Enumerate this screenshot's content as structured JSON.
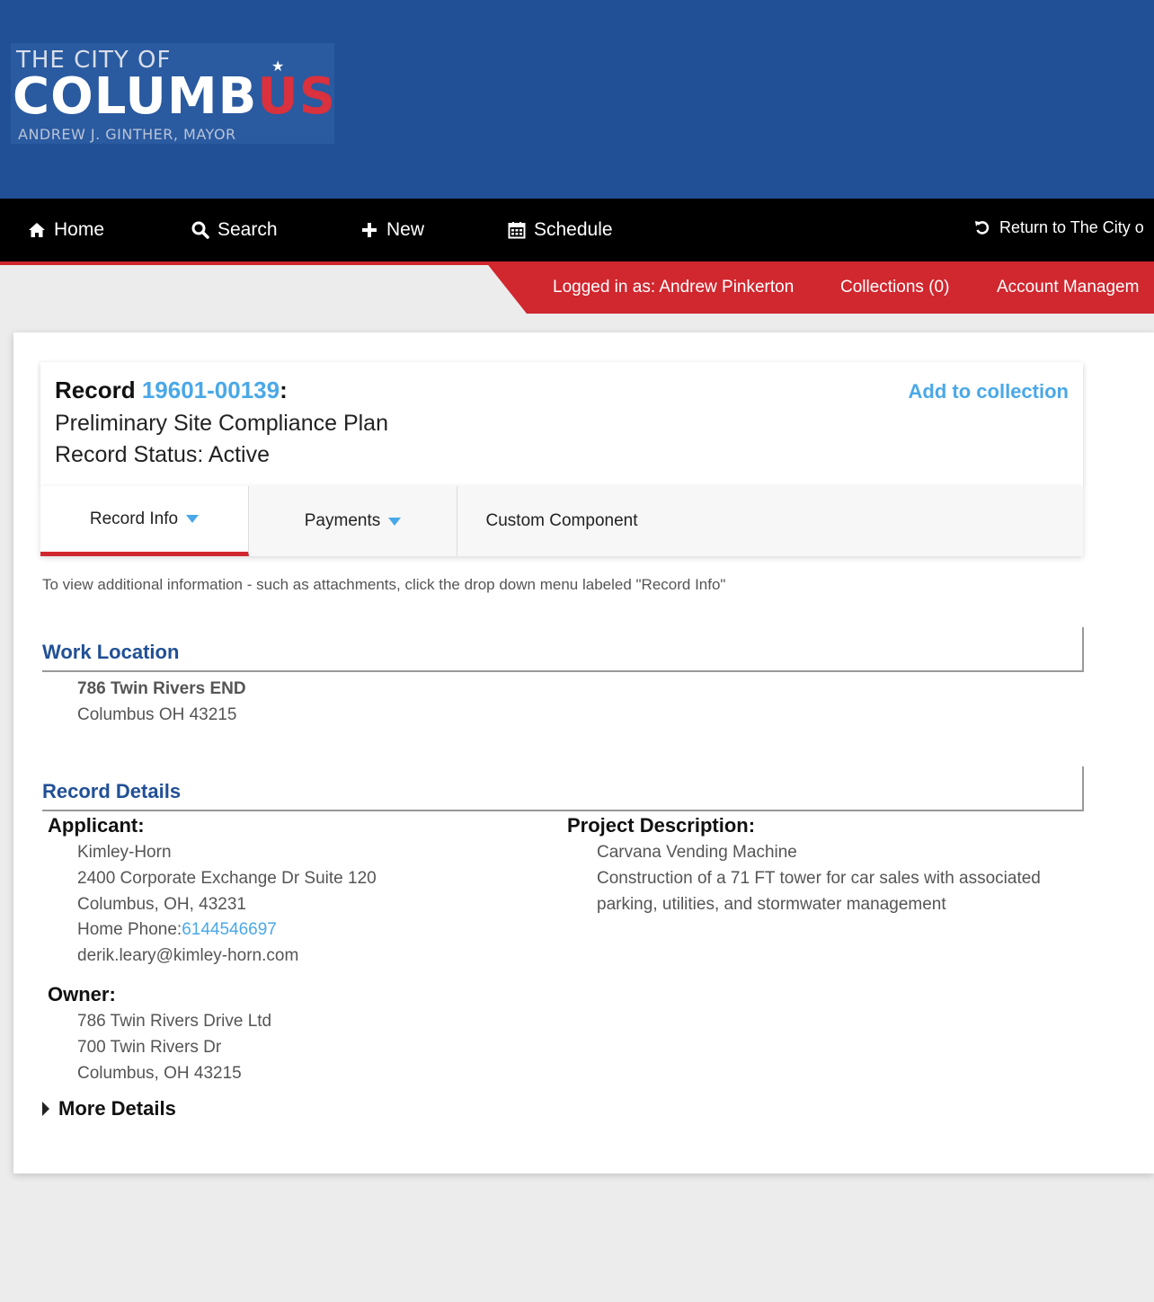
{
  "logo": {
    "line1": "THE CITY OF",
    "line2_main": "COLUMB",
    "line2_accent": "US",
    "line3": "ANDREW J. GINTHER, MAYOR"
  },
  "nav": {
    "home": "Home",
    "search": "Search",
    "new": "New",
    "schedule": "Schedule",
    "return": "Return to The City o"
  },
  "user_bar": {
    "logged_in": "Logged in as: Andrew Pinkerton",
    "collections": "Collections (0)",
    "account": "Account Managem"
  },
  "record": {
    "label": "Record",
    "number": "19601-00139",
    "colon": ":",
    "type": "Preliminary Site Compliance Plan",
    "status": "Record Status: Active",
    "add_to_collection": "Add to collection"
  },
  "tabs": {
    "record_info": "Record Info",
    "payments": "Payments",
    "custom": "Custom Component"
  },
  "hint": "To view additional information - such as attachments, click the drop down menu labeled \"Record Info\"",
  "work_location": {
    "title": "Work Location",
    "line1": "786 Twin Rivers END",
    "line2": "Columbus OH 43215"
  },
  "record_details": {
    "title": "Record Details",
    "applicant_label": "Applicant:",
    "applicant_name": "Kimley-Horn",
    "applicant_addr1": "2400 Corporate Exchange Dr Suite 120",
    "applicant_addr2": "Columbus, OH, 43231",
    "phone_label": "Home Phone:",
    "phone": "6144546697",
    "email": "derik.leary@kimley-horn.com",
    "owner_label": "Owner:",
    "owner_name": "786 Twin Rivers Drive Ltd",
    "owner_addr1": "700 Twin Rivers Dr",
    "owner_addr2": "Columbus, OH 43215",
    "project_label": "Project Description:",
    "project_name": "Carvana Vending Machine",
    "project_desc1": "Construction of a 71 FT tower for car sales with associated",
    "project_desc2": "parking, utilities, and stormwater management",
    "more_details": "More Details"
  },
  "colors": {
    "header_blue": "#215096",
    "accent_red": "#d1272f",
    "link_blue": "#4aa8e8"
  },
  "icons": [
    "home-icon",
    "search-icon",
    "plus-icon",
    "calendar-icon",
    "undo-icon",
    "caret-down-icon",
    "caret-right-icon",
    "star-icon"
  ]
}
